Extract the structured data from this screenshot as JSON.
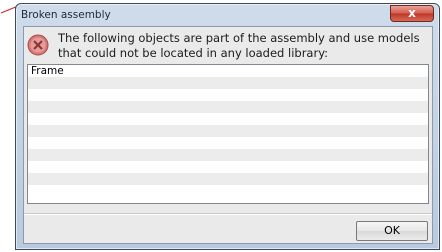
{
  "window": {
    "title": "Broken assembly",
    "close_glyph": "x"
  },
  "message": {
    "icon": "error-icon",
    "text": "The following objects are part of the assembly and use models that could not be located in any loaded library:"
  },
  "list": {
    "items": [
      "Frame",
      "",
      "",
      "",
      "",
      "",
      "",
      "",
      "",
      "",
      ""
    ]
  },
  "buttons": {
    "ok_label": "OK"
  },
  "colors": {
    "error_icon_fill": "#d77a78",
    "close_button": "#c0392b",
    "title_gradient_top": "#cfdcea",
    "title_gradient_bottom": "#b9cadf"
  }
}
